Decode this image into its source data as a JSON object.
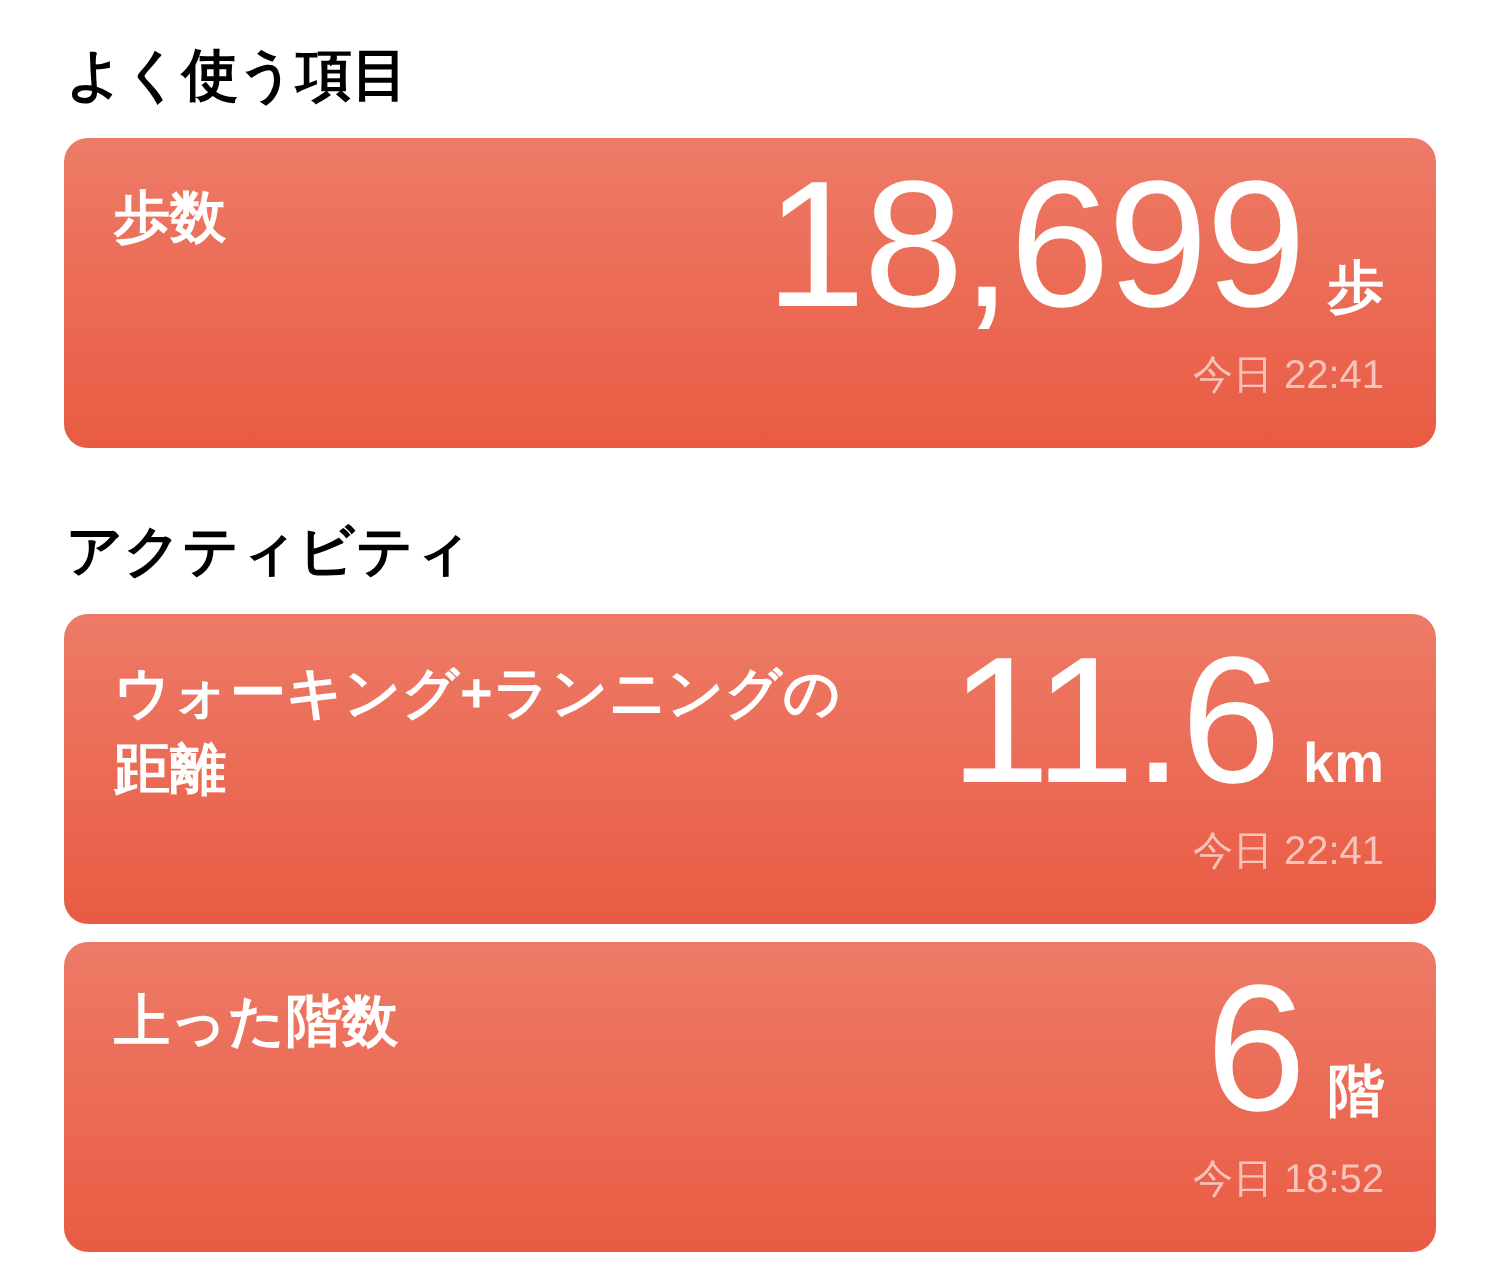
{
  "sections": [
    {
      "heading": "よく使う項目",
      "cards": [
        {
          "title": "歩数",
          "value": "18,699",
          "unit": "歩",
          "timestamp": "今日 22:41"
        }
      ]
    },
    {
      "heading": "アクティビティ",
      "cards": [
        {
          "title": "ウォーキング+ランニングの距離",
          "value": "11.6",
          "unit": "km",
          "timestamp": "今日 22:41"
        },
        {
          "title": "上った階数",
          "value": "6",
          "unit": "階",
          "timestamp": "今日 18:52"
        }
      ]
    }
  ]
}
